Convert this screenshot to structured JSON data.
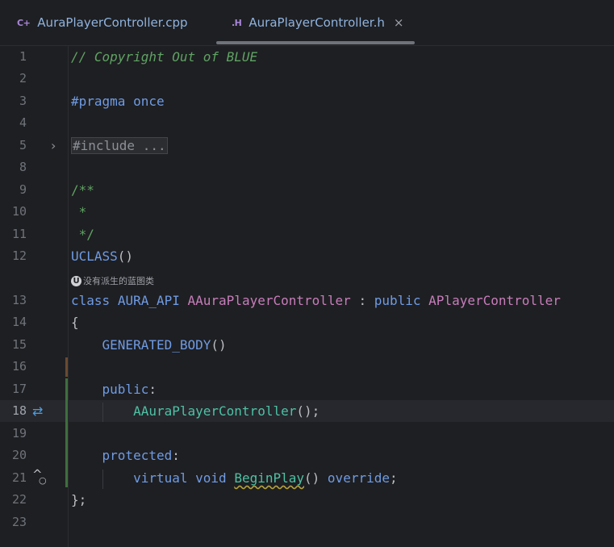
{
  "tabs": [
    {
      "icon_text": "C+",
      "label": "AuraPlayerController.cpp",
      "active": false
    },
    {
      "icon_text": ".H",
      "label": "AuraPlayerController.h",
      "active": true,
      "close": "×"
    }
  ],
  "gutter": {
    "fold_icon": "chevron-right-icon",
    "fold_glyph": "›",
    "impl_icon": "swap-arrows-icon",
    "impl_glyph": "⇄",
    "override_icon": "override-up-icon",
    "override_glyph": "^",
    "override_dot": "○"
  },
  "inlay_hint": {
    "icon_text": "U",
    "text": "没有派生的蓝图类"
  },
  "lines": [
    {
      "num": "1",
      "text": "// Copyright Out of BLUE"
    },
    {
      "num": "2",
      "text": ""
    },
    {
      "num": "3",
      "text": "#pragma once"
    },
    {
      "num": "4",
      "text": ""
    },
    {
      "num": "5",
      "text": "#include ..."
    },
    {
      "num": "8",
      "text": ""
    },
    {
      "num": "9",
      "text": "/**"
    },
    {
      "num": "10",
      "text": " *"
    },
    {
      "num": "11",
      "text": " */"
    },
    {
      "num": "12",
      "text": "UCLASS()"
    },
    {
      "num": "13",
      "text": "class AURA_API AAuraPlayerController : public APlayerController"
    },
    {
      "num": "14",
      "text": "{"
    },
    {
      "num": "15",
      "text": "    GENERATED_BODY()"
    },
    {
      "num": "16",
      "text": ""
    },
    {
      "num": "17",
      "text": "    public:"
    },
    {
      "num": "18",
      "text": "        AAuraPlayerController();"
    },
    {
      "num": "19",
      "text": ""
    },
    {
      "num": "20",
      "text": "    protected:"
    },
    {
      "num": "21",
      "text": "        virtual void BeginPlay() override;"
    },
    {
      "num": "22",
      "text": "};"
    },
    {
      "num": "23",
      "text": ""
    }
  ],
  "tokens": {
    "comment": "// Copyright Out of BLUE",
    "pragma": "#pragma",
    "once": "once",
    "include_fold": "#include ...",
    "doc_open": "/**",
    "doc_star": " *",
    "doc_close": " */",
    "uclass": "UCLASS",
    "parens": "()",
    "kw_class": "class",
    "api": "AURA_API",
    "class_name": "AAuraPlayerController",
    "colon": ":",
    "kw_public": "public",
    "base_class": "APlayerController",
    "brace_open": "{",
    "generated_body": "GENERATED_BODY",
    "public_label": "public",
    "ctor": "AAuraPlayerController",
    "ctor_tail": "();",
    "protected_label": "protected",
    "kw_virtual": "virtual",
    "kw_void": "void",
    "begin_play": "BeginPlay",
    "kw_override": "override",
    "semicolon": ";",
    "brace_close": "};"
  },
  "colors": {
    "background": "#1e1f22",
    "comment": "#5fa363",
    "keyword": "#6f9be4",
    "class_name": "#c77dbb",
    "function": "#4fc1a4",
    "added_change": "#3f6e3f",
    "modified_change": "#6a4a2f"
  }
}
